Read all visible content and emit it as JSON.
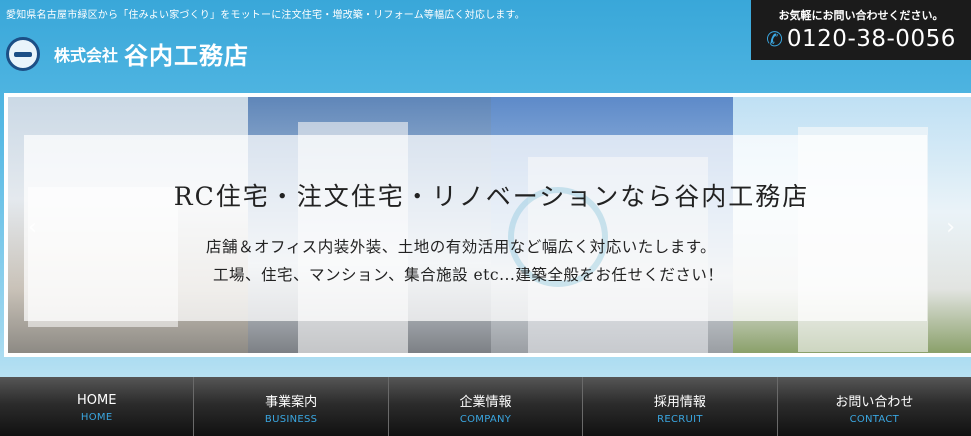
{
  "header": {
    "tagline": "愛知県名古屋市緑区から「住みよい家づくり」をモットーに注文住宅・増改築・リフォーム等幅広く対応します。",
    "company_prefix": "株式会社",
    "company_name": "谷内工務店",
    "logo_icon": "company-logo-icon"
  },
  "contact": {
    "label": "お気軽にお問い合わせください。",
    "phone_icon": "phone-icon",
    "phone": "0120-38-0056"
  },
  "hero": {
    "headline": "RC住宅・注文住宅・リノベーションなら谷内工務店",
    "line1": "店舗＆オフィス内装外装、土地の有効活用など幅広く対応いたします。",
    "line2": "工場、住宅、マンション、集合施設 etc...建築全般をお任せください！",
    "prev_icon": "‹",
    "next_icon": "›"
  },
  "nav": [
    {
      "ja": "HOME",
      "en": "HOME"
    },
    {
      "ja": "事業案内",
      "en": "BUSINESS"
    },
    {
      "ja": "企業情報",
      "en": "COMPANY"
    },
    {
      "ja": "採用情報",
      "en": "RECRUIT"
    },
    {
      "ja": "お問い合わせ",
      "en": "CONTACT"
    }
  ]
}
